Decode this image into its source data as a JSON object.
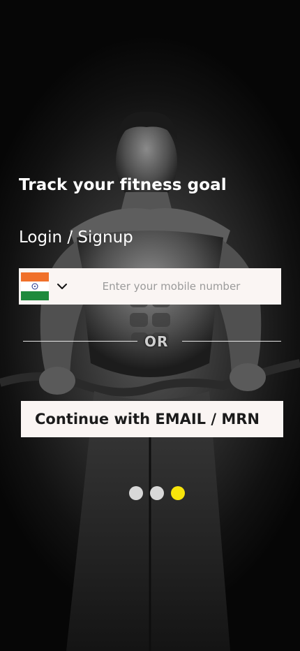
{
  "hero": {
    "title": "Track your fitness goal",
    "subtitle": "Login / Signup"
  },
  "phone_login": {
    "country_flag": "india-flag-icon",
    "dropdown_icon": "chevron-down-icon",
    "placeholder": "Enter your mobile number",
    "value": ""
  },
  "divider": {
    "label": "OR"
  },
  "email_login": {
    "label": "Continue with EMAIL / MRN"
  },
  "carousel": {
    "total_slides": 3,
    "active_slide": 3
  },
  "colors": {
    "field_bg": "#faf5f3",
    "active_dot": "#f7e40b",
    "inactive_dot": "#d8d8d8",
    "text_light": "#ffffff"
  }
}
